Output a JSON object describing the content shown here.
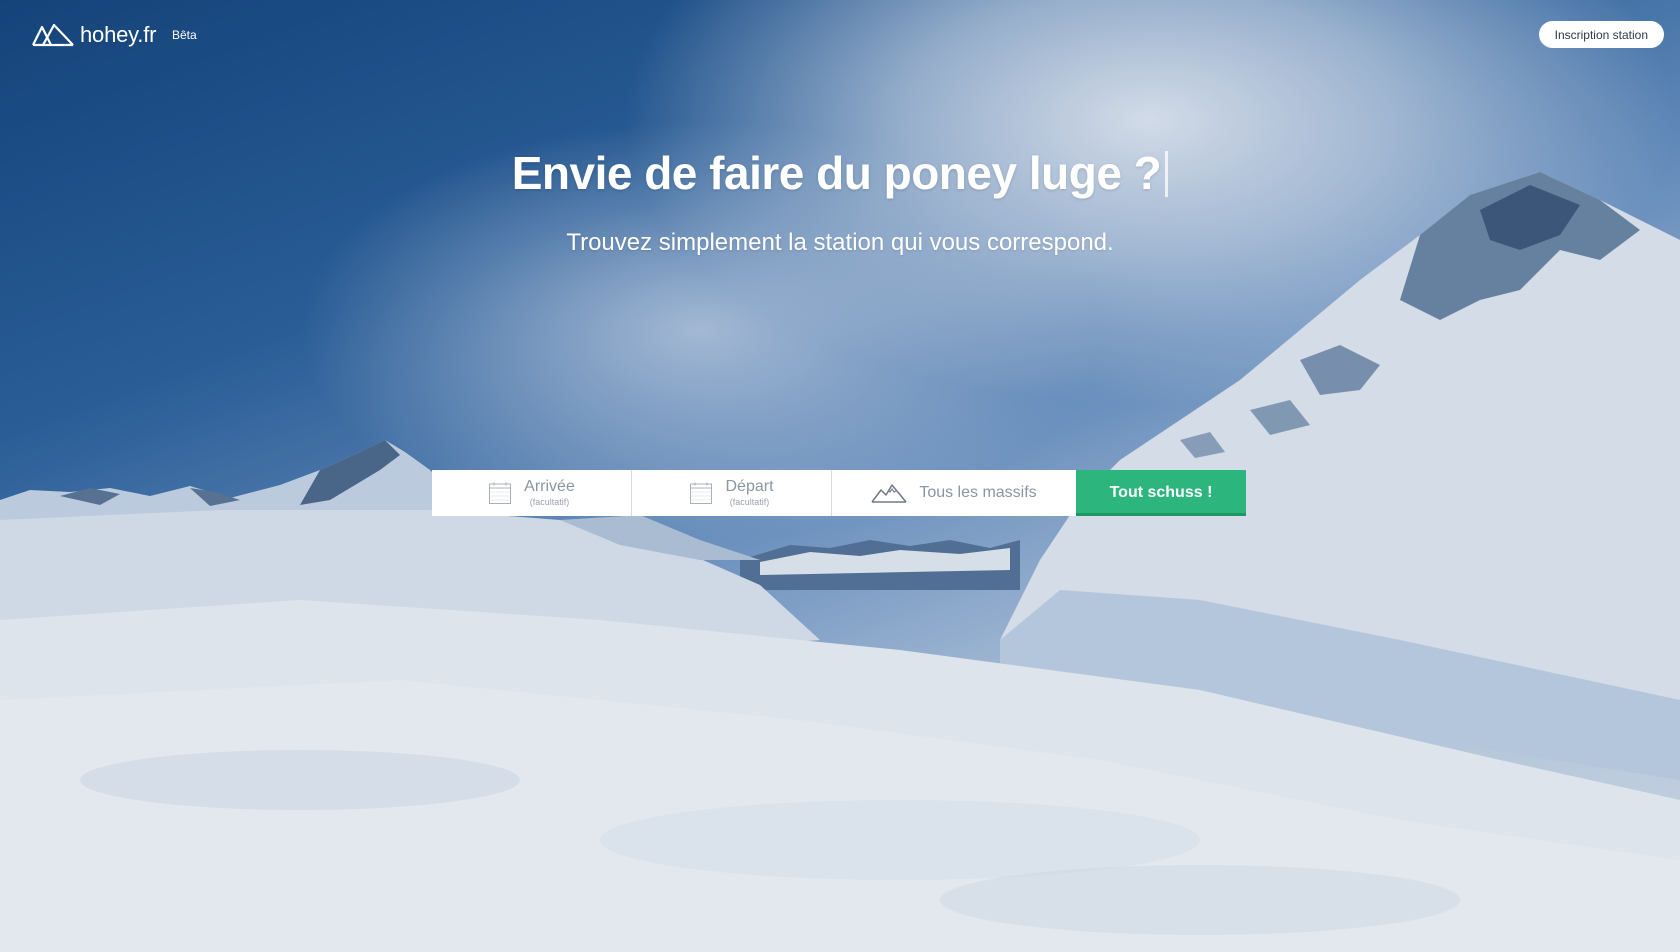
{
  "header": {
    "logo_text": "hohey.fr",
    "beta_label": "Bêta",
    "signup_label": "Inscription station"
  },
  "hero": {
    "title": "Envie de faire du poney luge ?",
    "subtitle": "Trouvez simplement la station qui vous correspond."
  },
  "search": {
    "arrival_label": "Arrivée",
    "arrival_hint": "(facultatif)",
    "departure_label": "Départ",
    "departure_hint": "(facultatif)",
    "massif_label": "Tous les massifs",
    "submit_label": "Tout schuss !"
  },
  "icons": {
    "logo": "mountains-logo-icon",
    "arrival": "calendar-icon",
    "departure": "calendar-icon",
    "massif": "mountain-icon"
  },
  "colors": {
    "accent": "#2cb67d",
    "accent_dark": "#21965f",
    "field_text": "#8b96a3"
  }
}
